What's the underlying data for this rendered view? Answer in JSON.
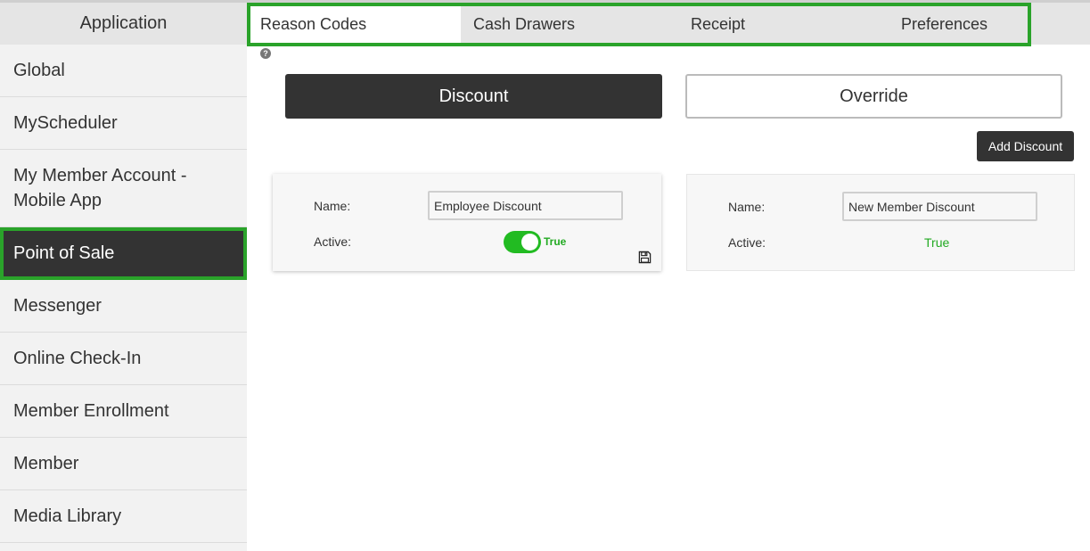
{
  "sidebar": {
    "header": "Application",
    "items": [
      {
        "label": "Global"
      },
      {
        "label": "MyScheduler"
      },
      {
        "label": "My Member Account -\nMobile App"
      },
      {
        "label": "Point of Sale"
      },
      {
        "label": "Messenger"
      },
      {
        "label": "Online Check-In"
      },
      {
        "label": "Member Enrollment"
      },
      {
        "label": "Member"
      },
      {
        "label": "Media Library"
      }
    ]
  },
  "tabs": [
    {
      "label": "Reason Codes"
    },
    {
      "label": "Cash Drawers"
    },
    {
      "label": "Receipt"
    },
    {
      "label": "Preferences"
    }
  ],
  "help_icon": "?",
  "segments": {
    "discount": "Discount",
    "override": "Override"
  },
  "add_button": "Add Discount",
  "cards": [
    {
      "name_label": "Name:",
      "name_value": "Employee Discount",
      "active_label": "Active:",
      "active_value": "True"
    },
    {
      "name_label": "Name:",
      "name_value": "New Member Discount",
      "active_label": "Active:",
      "active_value": "True"
    }
  ],
  "colors": {
    "accent_green": "#2aa32a",
    "toggle_green": "#22bb22",
    "dark": "#333333"
  }
}
